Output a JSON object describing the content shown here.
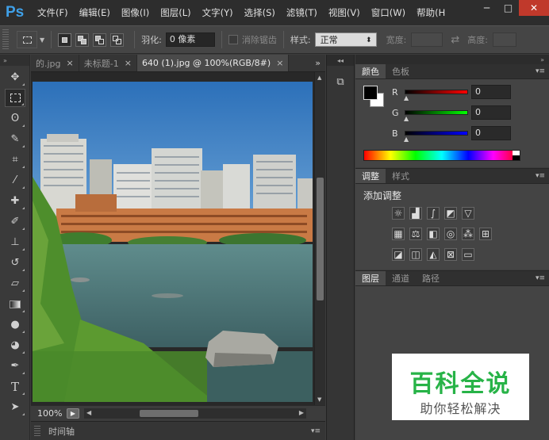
{
  "app": {
    "logo": "Ps"
  },
  "menu": [
    "文件(F)",
    "编辑(E)",
    "图像(I)",
    "图层(L)",
    "文字(Y)",
    "选择(S)",
    "滤镜(T)",
    "视图(V)",
    "窗口(W)",
    "帮助(H"
  ],
  "window_buttons": {
    "minimize": "─",
    "maximize": "□",
    "close": "✕"
  },
  "options": {
    "feather_label": "羽化:",
    "feather_value": "0 像素",
    "antialias_label": "消除锯齿",
    "style_label": "样式:",
    "style_value": "正常",
    "width_label": "宽度:",
    "height_label": "高度:"
  },
  "tools": [
    "move-tool-icon",
    "marquee-tool-icon",
    "lasso-tool-icon",
    "quick-select-tool-icon",
    "crop-tool-icon",
    "eyedropper-tool-icon",
    "healing-brush-icon",
    "brush-tool-icon",
    "stamp-tool-icon",
    "history-brush-icon",
    "eraser-tool-icon",
    "gradient-tool-icon",
    "blur-tool-icon",
    "dodge-tool-icon",
    "pen-tool-icon",
    "type-tool-icon",
    "path-select-icon"
  ],
  "doc_tabs": [
    {
      "title": "的.jpg",
      "close": "×"
    },
    {
      "title": "未标题-1",
      "close": "×"
    },
    {
      "title": "640 (1).jpg @ 100%(RGB/8#)",
      "close": "×",
      "active": true
    }
  ],
  "tabs_more": "»",
  "status": {
    "zoom": "100%"
  },
  "timeline": {
    "label": "时间轴"
  },
  "color_panel": {
    "tabs": [
      "颜色",
      "色板"
    ],
    "channels": [
      {
        "label": "R",
        "value": "0",
        "color": "#ff0000"
      },
      {
        "label": "G",
        "value": "0",
        "color": "#00ff00"
      },
      {
        "label": "B",
        "value": "0",
        "color": "#0000ff"
      }
    ]
  },
  "adjustments_panel": {
    "tabs": [
      "调整",
      "样式"
    ],
    "title": "添加调整"
  },
  "layers_panel": {
    "tabs": [
      "图层",
      "通道",
      "路径"
    ]
  },
  "watermark": {
    "main": "百科全说",
    "sub": "助你轻松解决"
  },
  "colors": {
    "accent": "#3fa0e8",
    "watermark_green": "#27b347"
  }
}
